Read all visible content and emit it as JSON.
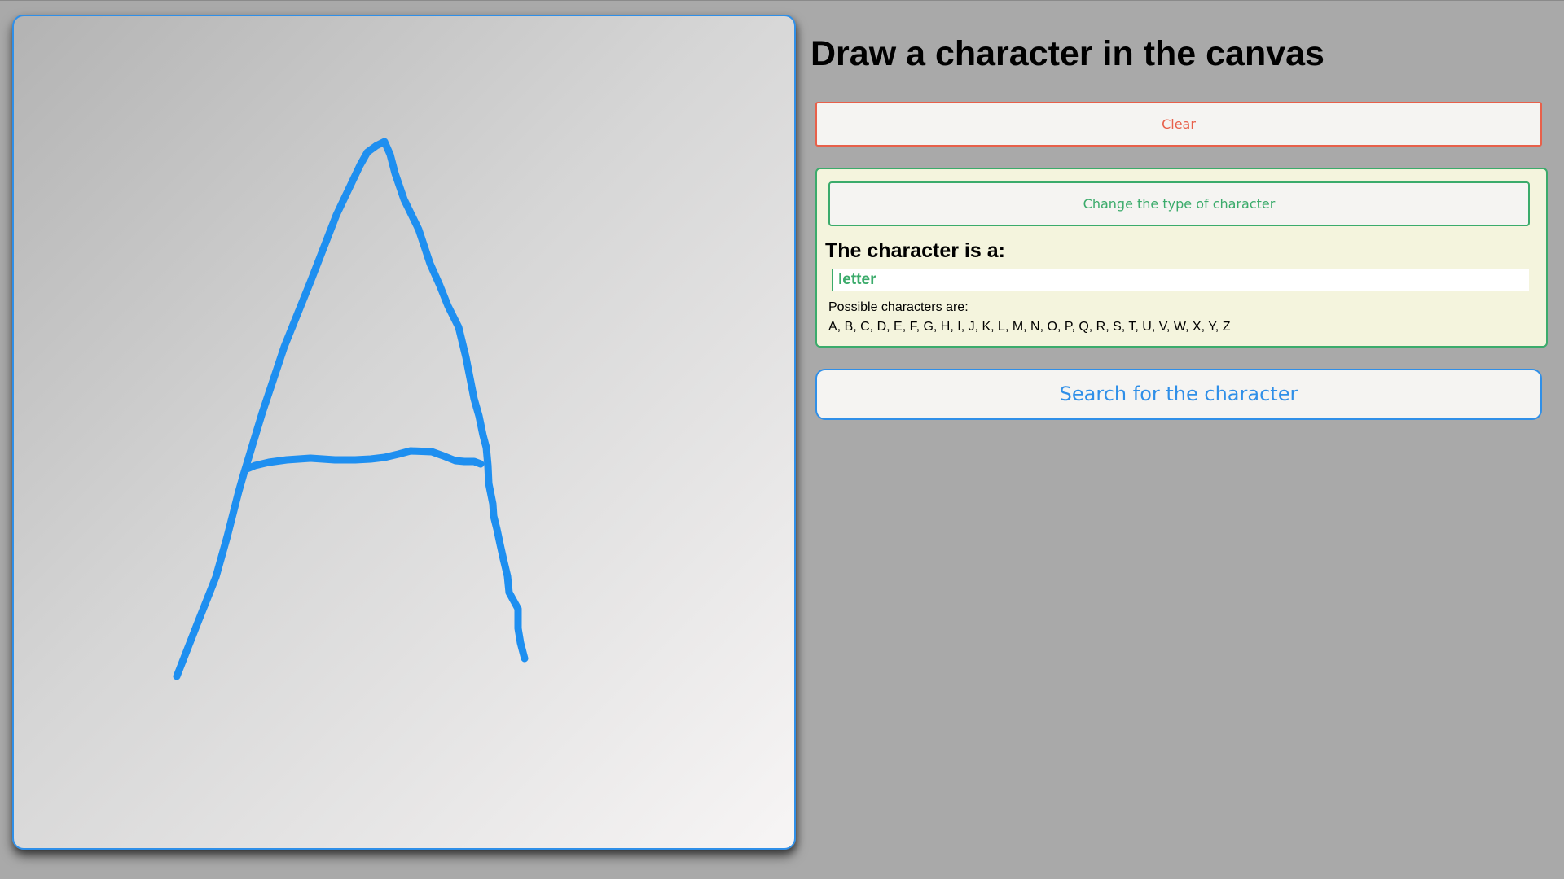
{
  "canvas": {
    "stroke_color": "#1e8ff0"
  },
  "panel": {
    "title": "Draw a character in the canvas",
    "clear_label": "Clear",
    "change_type_label": "Change the type of character",
    "character_heading": "The character is a:",
    "character_type_value": "letter",
    "possible_label": "Possible characters are:",
    "possible_characters": "A, B, C, D, E, F, G, H, I, J, K, L, M, N, O, P, Q, R, S, T, U, V, W, X, Y, Z",
    "search_label": "Search for the character"
  },
  "colors": {
    "background": "#a9a9a9",
    "accent_blue": "#2f8fe8",
    "accent_red": "#e8604a",
    "accent_green": "#3bab6b",
    "type_box_bg": "#f4f4dd"
  }
}
